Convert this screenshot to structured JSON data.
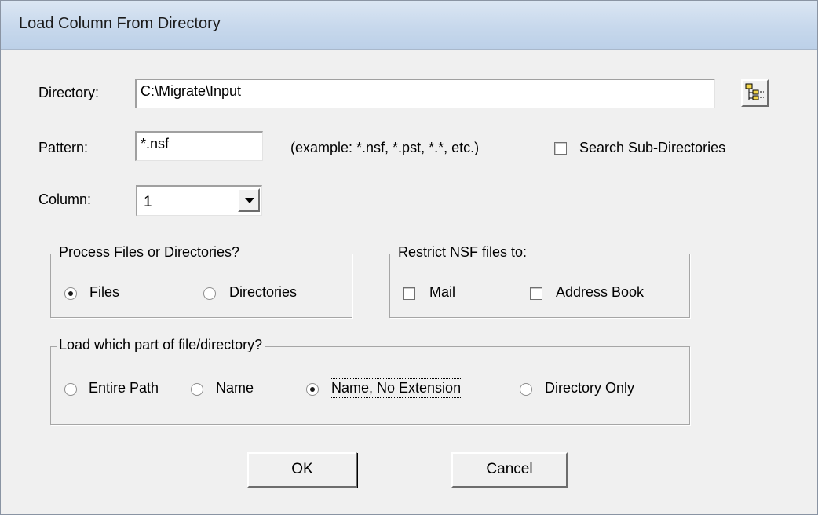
{
  "window": {
    "title": "Load Column From Directory"
  },
  "directory": {
    "label": "Directory:",
    "value": "C:\\Migrate\\Input",
    "browse_icon": "folder-tree-icon"
  },
  "pattern": {
    "label": "Pattern:",
    "value": "*.nsf",
    "example": "(example: *.nsf, *.pst, *.*, etc.)",
    "search_sub_label": "Search Sub-Directories",
    "search_sub_checked": false
  },
  "column": {
    "label": "Column:",
    "selected": "1"
  },
  "process_group": {
    "title": "Process Files or Directories?",
    "options": [
      {
        "label": "Files",
        "selected": true
      },
      {
        "label": "Directories",
        "selected": false
      }
    ]
  },
  "restrict_group": {
    "title": "Restrict NSF files to:",
    "options": [
      {
        "label": "Mail",
        "checked": false
      },
      {
        "label": "Address Book",
        "checked": false
      }
    ]
  },
  "load_part_group": {
    "title": "Load which part of file/directory?",
    "options": [
      {
        "label": "Entire Path",
        "selected": false
      },
      {
        "label": "Name",
        "selected": false
      },
      {
        "label": "Name, No Extension",
        "selected": true
      },
      {
        "label": "Directory Only",
        "selected": false
      }
    ]
  },
  "buttons": {
    "ok": "OK",
    "cancel": "Cancel"
  }
}
